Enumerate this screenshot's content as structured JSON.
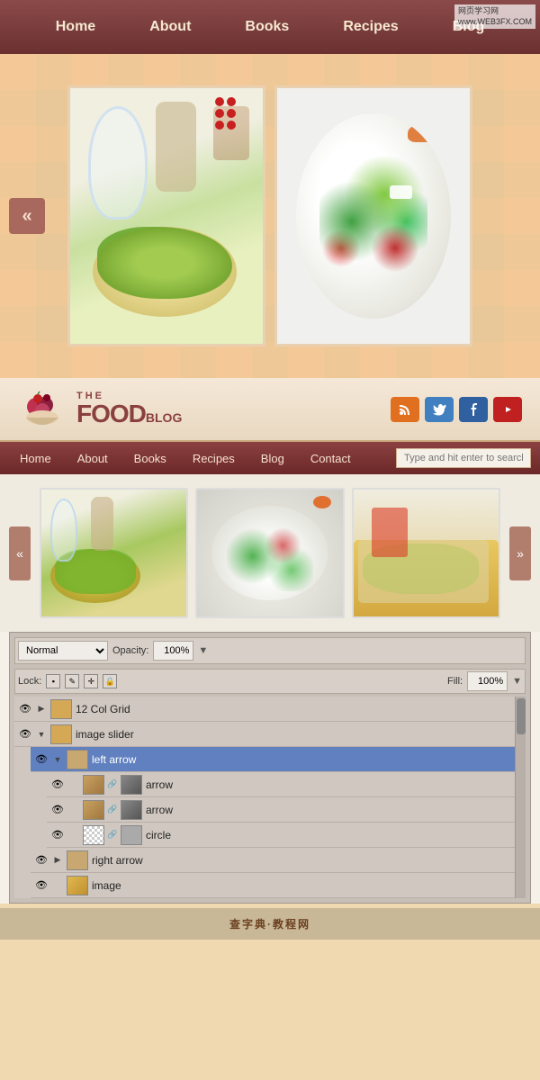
{
  "nav": {
    "home": "Home",
    "about": "About",
    "books": "Books",
    "recipes": "Recipes",
    "blog": "Blog",
    "contact": "Contact"
  },
  "watermark": {
    "line1": "网页学习网",
    "line2": "www.WEB3FX.COM"
  },
  "logo": {
    "the": "THE",
    "food": "FOOD",
    "blog": "BLOG"
  },
  "search": {
    "placeholder": "Type and hit enter to search"
  },
  "slider": {
    "left_arrow": "«",
    "right_arrow": "»"
  },
  "layers": {
    "blend_mode": "Normal",
    "opacity_label": "Opacity:",
    "opacity_value": "100%",
    "lock_label": "Lock:",
    "fill_label": "Fill:",
    "fill_value": "100%",
    "items": [
      {
        "name": "12 Col Grid",
        "level": 0,
        "expanded": false,
        "type": "folder"
      },
      {
        "name": "image slider",
        "level": 0,
        "expanded": true,
        "type": "folder"
      },
      {
        "name": "left arrow",
        "level": 1,
        "expanded": true,
        "type": "folder",
        "selected": true
      },
      {
        "name": "arrow",
        "level": 2,
        "type": "layer",
        "thumb1": "brown",
        "thumb2": "grey"
      },
      {
        "name": "arrow",
        "level": 2,
        "type": "layer",
        "thumb1": "brown",
        "thumb2": "grey"
      },
      {
        "name": "circle",
        "level": 2,
        "type": "layer",
        "thumb1": "checker",
        "thumb2": "grey"
      },
      {
        "name": "right arrow",
        "level": 1,
        "expanded": false,
        "type": "folder"
      },
      {
        "name": "image",
        "level": 1,
        "type": "layer",
        "thumb1": "food"
      }
    ]
  },
  "footer": {
    "text": "查字典·教程网"
  }
}
